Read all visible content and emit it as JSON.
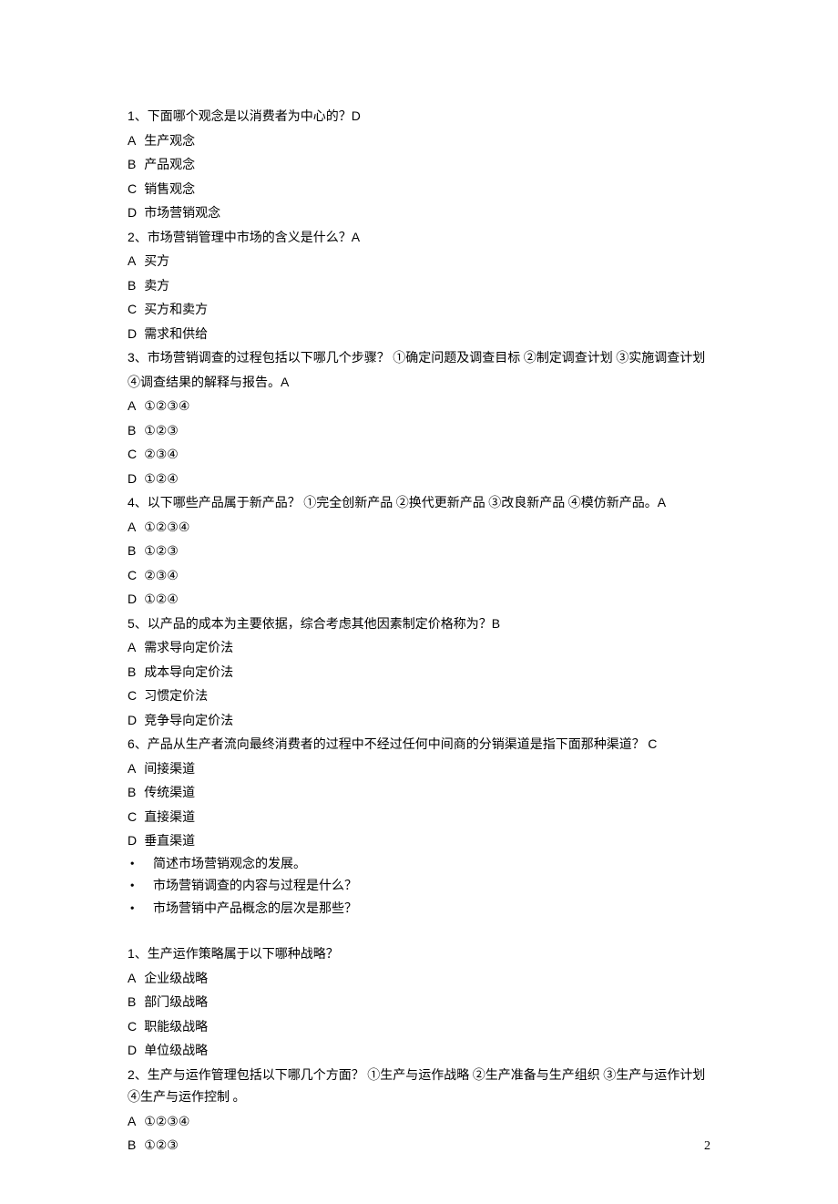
{
  "q1": {
    "num": "1、",
    "text": "下面哪个观念是以消费者为中心的？",
    "ans": "D",
    "opts": {
      "A": "生产观念",
      "B": "产品观念",
      "C": "销售观念",
      "D": "市场营销观念"
    }
  },
  "q2": {
    "num": "2、",
    "text": "市场营销管理中市场的含义是什么？",
    "ans": "A",
    "opts": {
      "A": "买方",
      "B": "卖方",
      "C": "买方和卖方",
      "D": "需求和供给"
    }
  },
  "q3": {
    "num": "3、",
    "text": "市场营销调查的过程包括以下哪几个步骤？ ①确定问题及调查目标 ②制定调查计划 ③实施调查计划 ④调查结果的解释与报告。",
    "ans": "A",
    "opts": {
      "A": "①②③④",
      "B": "①②③",
      "C": "②③④",
      "D": "①②④"
    }
  },
  "q4": {
    "num": "4、",
    "text": "以下哪些产品属于新产品？ ①完全创新产品 ②换代更新产品 ③改良新产品 ④模仿新产品。",
    "ans": "A",
    "opts": {
      "A": "①②③④",
      "B": "①②③",
      "C": "②③④",
      "D": "①②④"
    }
  },
  "q5": {
    "num": "5、",
    "text": "以产品的成本为主要依据，综合考虑其他因素制定价格称为？",
    "ans": "B",
    "opts": {
      "A": "需求导向定价法",
      "B": "成本导向定价法",
      "C": "习惯定价法",
      "D": "竞争导向定价法"
    }
  },
  "q6": {
    "num": "6、",
    "text": "产品从生产者流向最终消费者的过程中不经过任何中间商的分销渠道是指下面那种渠道？ ",
    "ans": "C",
    "opts": {
      "A": "间接渠道",
      "B": "传统渠道",
      "C": "直接渠道",
      "D": "垂直渠道"
    }
  },
  "bullets": {
    "b1": "简述市场营销观念的发展。",
    "b2": "市场营销调查的内容与过程是什么？",
    "b3": "市场营销中产品概念的层次是那些？"
  },
  "s1": {
    "num": "1、",
    "text": "生产运作策略属于以下哪种战略？",
    "opts": {
      "A": "企业级战略",
      "B": "部门级战略",
      "C": "职能级战略",
      "D": "单位级战略"
    }
  },
  "s2": {
    "num": "2、",
    "text": "生产与运作管理包括以下哪几个方面？ ①生产与运作战略 ②生产准备与生产组织 ③生产与运作计划 ④生产与运作控制 。",
    "opts": {
      "A": "①②③④",
      "B": "①②③"
    }
  },
  "page_number": "2"
}
